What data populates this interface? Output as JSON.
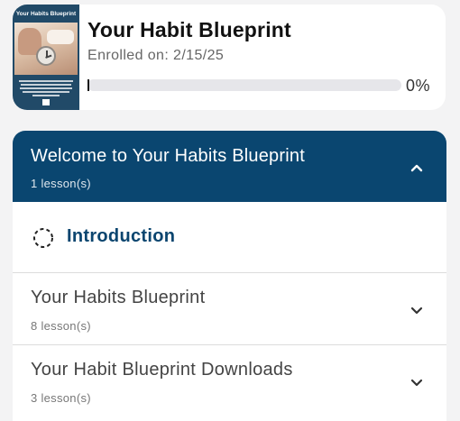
{
  "course": {
    "thumbnail_title": "Your Habits Blueprint",
    "title": "Your Habit Blueprint",
    "enrolled_label": "Enrolled on: 2/15/25",
    "progress_percent_label": "0%",
    "progress_value": 0
  },
  "sections": [
    {
      "title": "Welcome to Your Habits Blueprint",
      "count": "1 lesson(s)",
      "expanded": true,
      "icon": "chevron-up-icon",
      "lessons": [
        {
          "label": "Introduction",
          "status_icon": "incomplete-circle-icon"
        }
      ]
    },
    {
      "title": "Your Habits Blueprint",
      "count": "8 lesson(s)",
      "expanded": false,
      "icon": "chevron-down-icon"
    },
    {
      "title": "Your Habit Blueprint Downloads",
      "count": "3 lesson(s)",
      "expanded": false,
      "icon": "chevron-down-icon"
    }
  ],
  "colors": {
    "accent": "#0a4670",
    "background": "#f3f3f4",
    "card": "#ffffff",
    "track": "#e6e6ea"
  }
}
